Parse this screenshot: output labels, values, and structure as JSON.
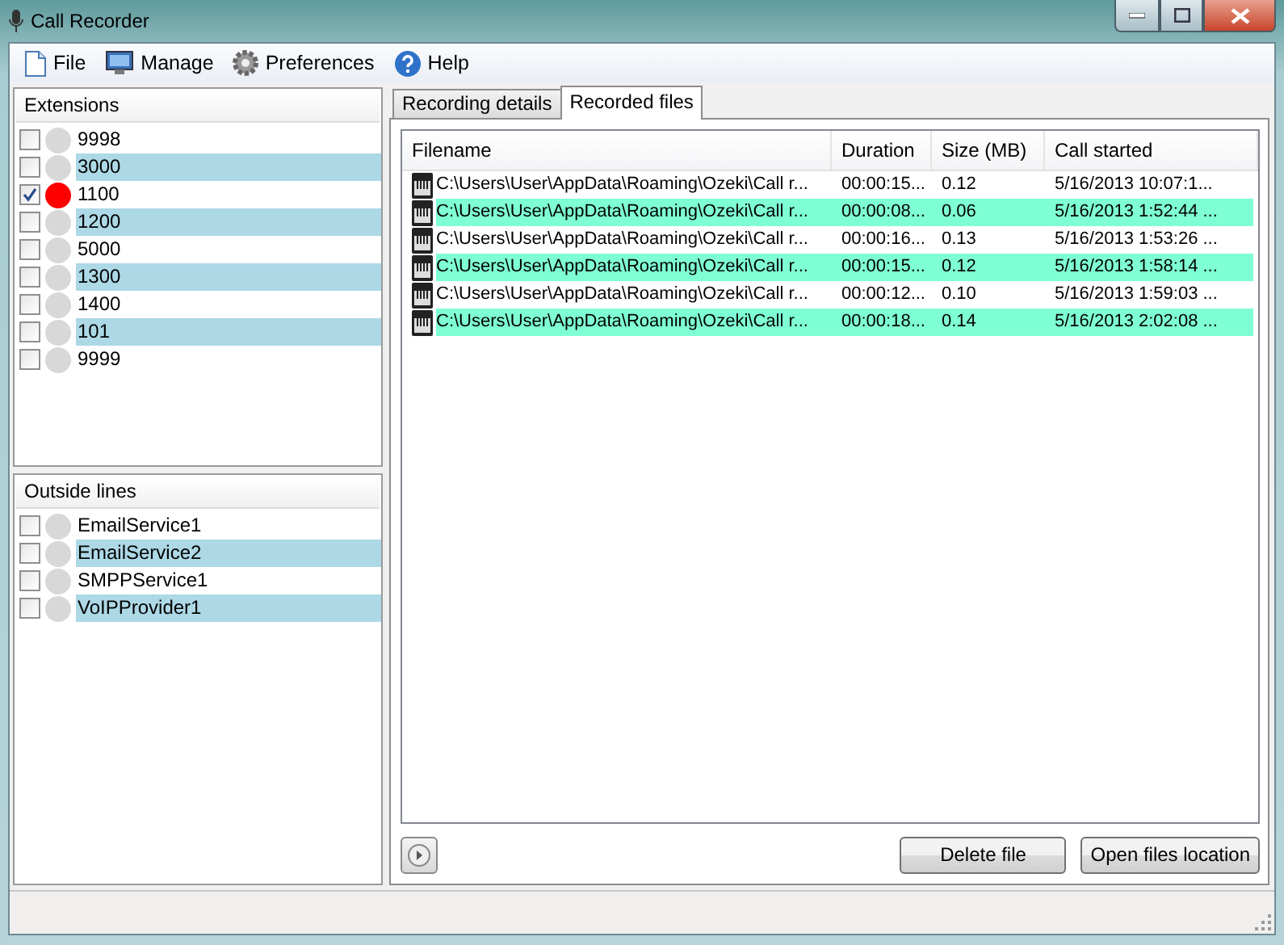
{
  "window": {
    "title": "Call Recorder"
  },
  "menu": [
    {
      "label": "File"
    },
    {
      "label": "Manage"
    },
    {
      "label": "Preferences"
    },
    {
      "label": "Help"
    }
  ],
  "extensions": {
    "title": "Extensions",
    "items": [
      {
        "label": "9998",
        "checked": false,
        "color": "#d8d8d8"
      },
      {
        "label": "3000",
        "checked": false,
        "color": "#d8d8d8"
      },
      {
        "label": "1100",
        "checked": true,
        "color": "#ff0000"
      },
      {
        "label": "1200",
        "checked": false,
        "color": "#d8d8d8"
      },
      {
        "label": "5000",
        "checked": false,
        "color": "#d8d8d8"
      },
      {
        "label": "1300",
        "checked": false,
        "color": "#d8d8d8"
      },
      {
        "label": "1400",
        "checked": false,
        "color": "#d8d8d8"
      },
      {
        "label": "101",
        "checked": false,
        "color": "#d8d8d8"
      },
      {
        "label": "9999",
        "checked": false,
        "color": "#d8d8d8"
      }
    ]
  },
  "outside_lines": {
    "title": "Outside lines",
    "items": [
      {
        "label": "EmailService1",
        "checked": false,
        "color": "#d8d8d8"
      },
      {
        "label": "EmailService2",
        "checked": false,
        "color": "#d8d8d8"
      },
      {
        "label": "SMPPService1",
        "checked": false,
        "color": "#d8d8d8"
      },
      {
        "label": "VoIPProvider1",
        "checked": false,
        "color": "#d8d8d8"
      }
    ]
  },
  "tabs": [
    {
      "label": "Recording details",
      "selected": false
    },
    {
      "label": "Recorded files",
      "selected": true
    }
  ],
  "table": {
    "columns": [
      "Filename",
      "Duration",
      "Size (MB)",
      "Call started"
    ],
    "rows": [
      [
        "C:\\Users\\User\\AppData\\Roaming\\Ozeki\\Call r...",
        "00:00:15...",
        "0.12",
        "5/16/2013 10:07:1..."
      ],
      [
        "C:\\Users\\User\\AppData\\Roaming\\Ozeki\\Call r...",
        "00:00:08...",
        "0.06",
        "5/16/2013 1:52:44 ..."
      ],
      [
        "C:\\Users\\User\\AppData\\Roaming\\Ozeki\\Call r...",
        "00:00:16...",
        "0.13",
        "5/16/2013 1:53:26 ..."
      ],
      [
        "C:\\Users\\User\\AppData\\Roaming\\Ozeki\\Call r...",
        "00:00:15...",
        "0.12",
        "5/16/2013 1:58:14 ..."
      ],
      [
        "C:\\Users\\User\\AppData\\Roaming\\Ozeki\\Call r...",
        "00:00:12...",
        "0.10",
        "5/16/2013 1:59:03 ..."
      ],
      [
        "C:\\Users\\User\\AppData\\Roaming\\Ozeki\\Call r...",
        "00:00:18...",
        "0.14",
        "5/16/2013 2:02:08 ..."
      ]
    ]
  },
  "buttons": [
    "Delete file",
    "Open files location"
  ]
}
